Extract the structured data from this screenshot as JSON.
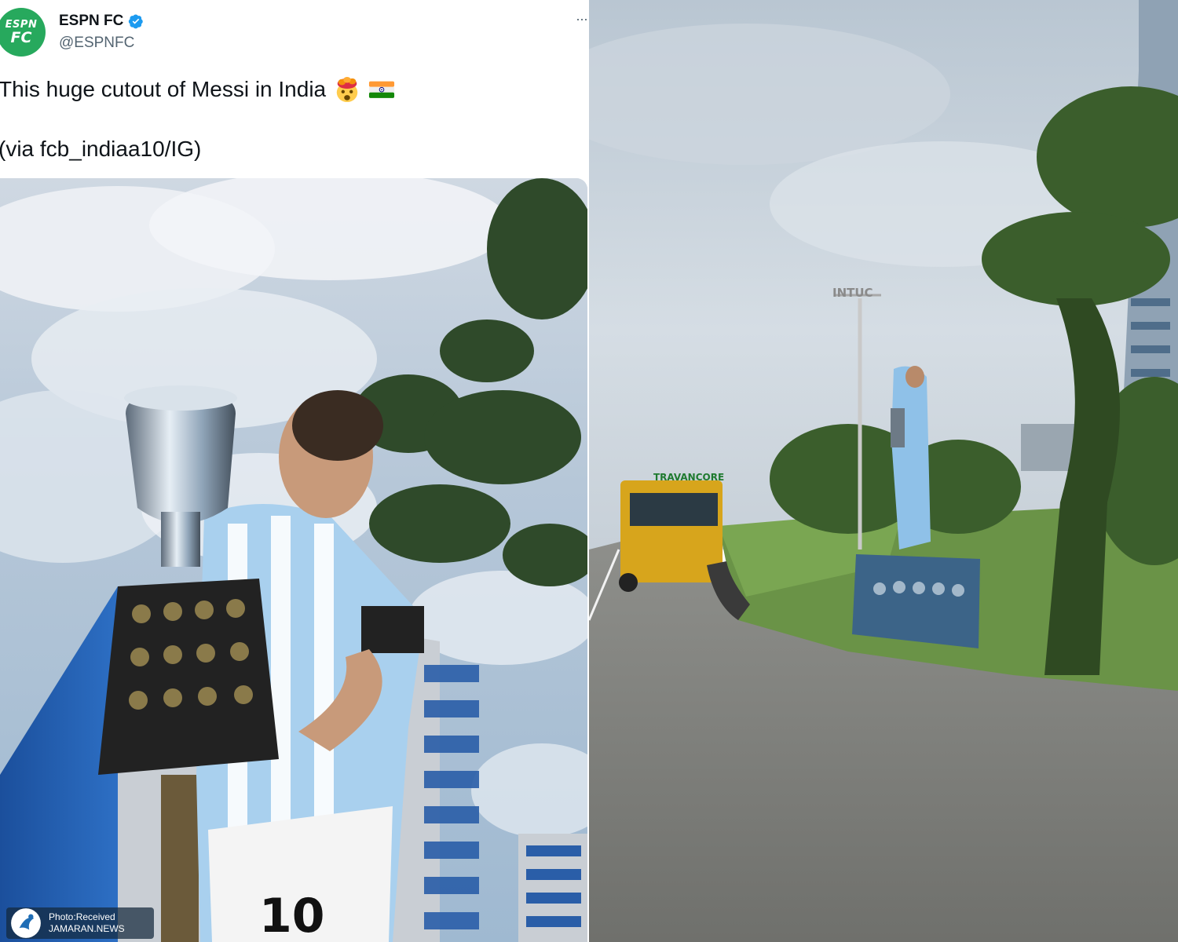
{
  "tweet": {
    "display_name": "ESPN FC",
    "handle": "@ESPNFC",
    "avatar_line1": "ESPN",
    "avatar_line2": "FC",
    "more_label": "···",
    "text_line1": "This huge cutout of Messi in India",
    "text_line2": "(via fcb_indiaa10/IG)",
    "emojis": [
      "exploding-head-emoji",
      "india-flag-emoji"
    ]
  },
  "watermark": {
    "line1": "Photo:Received",
    "line2": "JAMARAN.NEWS"
  },
  "photo": {
    "tower_sign": "INTUC",
    "bus_sign": "TRAVANCORE"
  },
  "colors": {
    "espn_green": "#27a95d",
    "verified_blue": "#1d9bf0",
    "text_primary": "#0f1419",
    "text_secondary": "#536471"
  }
}
